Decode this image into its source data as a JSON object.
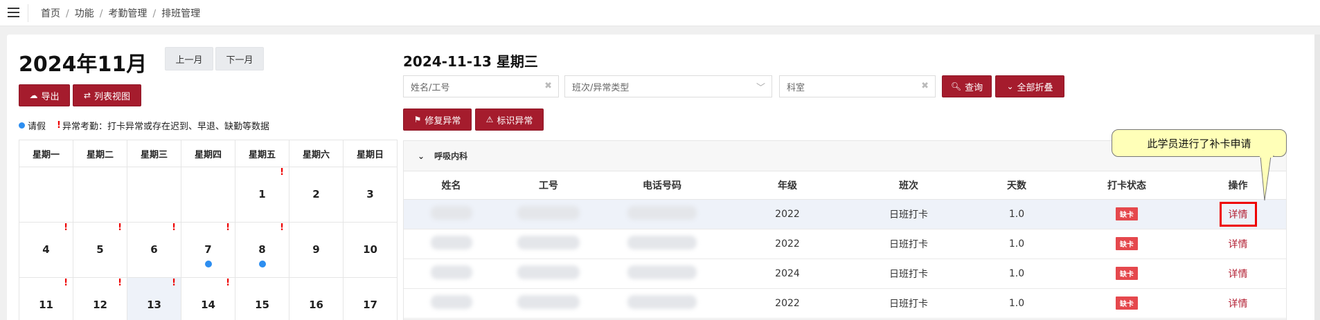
{
  "breadcrumb": [
    "首页",
    "功能",
    "考勤管理",
    "排班管理"
  ],
  "calendar": {
    "month_title": "2024年11月",
    "prev_label": "上一月",
    "next_label": "下一月",
    "export_label": "导出",
    "list_view_label": "列表视图",
    "legend_leave": "请假",
    "legend_abnormal": "异常考勤：打卡异常或存在迟到、早退、缺勤等数据",
    "weekdays": [
      "星期一",
      "星期二",
      "星期三",
      "星期四",
      "星期五",
      "星期六",
      "星期日"
    ],
    "rows": [
      [
        {
          "d": ""
        },
        {
          "d": ""
        },
        {
          "d": ""
        },
        {
          "d": ""
        },
        {
          "d": "1",
          "flag": true
        },
        {
          "d": "2"
        },
        {
          "d": "3"
        }
      ],
      [
        {
          "d": "4",
          "flag": true
        },
        {
          "d": "5",
          "flag": true
        },
        {
          "d": "6",
          "flag": true
        },
        {
          "d": "7",
          "flag": true,
          "dot": true
        },
        {
          "d": "8",
          "flag": true,
          "dot": true
        },
        {
          "d": "9"
        },
        {
          "d": "10"
        }
      ],
      [
        {
          "d": "11",
          "flag": true
        },
        {
          "d": "12",
          "flag": true
        },
        {
          "d": "13",
          "flag": true,
          "selected": true
        },
        {
          "d": "14",
          "flag": true
        },
        {
          "d": "15"
        },
        {
          "d": "16"
        },
        {
          "d": "17"
        }
      ]
    ]
  },
  "detail": {
    "date_title": "2024-11-13 星期三",
    "name_placeholder": "姓名/工号",
    "shift_placeholder": "班次/异常类型",
    "dept_placeholder": "科室",
    "query_label": "查询",
    "collapse_label": "全部折叠",
    "fix_label": "修复异常",
    "mark_label": "标识异常",
    "group_name": "呼吸内科",
    "columns": [
      "姓名",
      "工号",
      "电话号码",
      "年级",
      "班次",
      "天数",
      "打卡状态",
      "操作"
    ],
    "rows": [
      {
        "grade": "2022",
        "shift": "日班打卡",
        "days": "1.0",
        "status": "缺卡",
        "action": "详情",
        "highlight": true
      },
      {
        "grade": "2022",
        "shift": "日班打卡",
        "days": "1.0",
        "status": "缺卡",
        "action": "详情"
      },
      {
        "grade": "2024",
        "shift": "日班打卡",
        "days": "1.0",
        "status": "缺卡",
        "action": "详情"
      },
      {
        "grade": "2022",
        "shift": "日班打卡",
        "days": "1.0",
        "status": "缺卡",
        "action": "详情"
      }
    ]
  },
  "callout_text": "此学员进行了补卡申请",
  "colors": {
    "accent": "#a51c2d",
    "leave_dot": "#2d8ef0",
    "abnormal": "#e00000",
    "highlight_box": "#e00000"
  }
}
